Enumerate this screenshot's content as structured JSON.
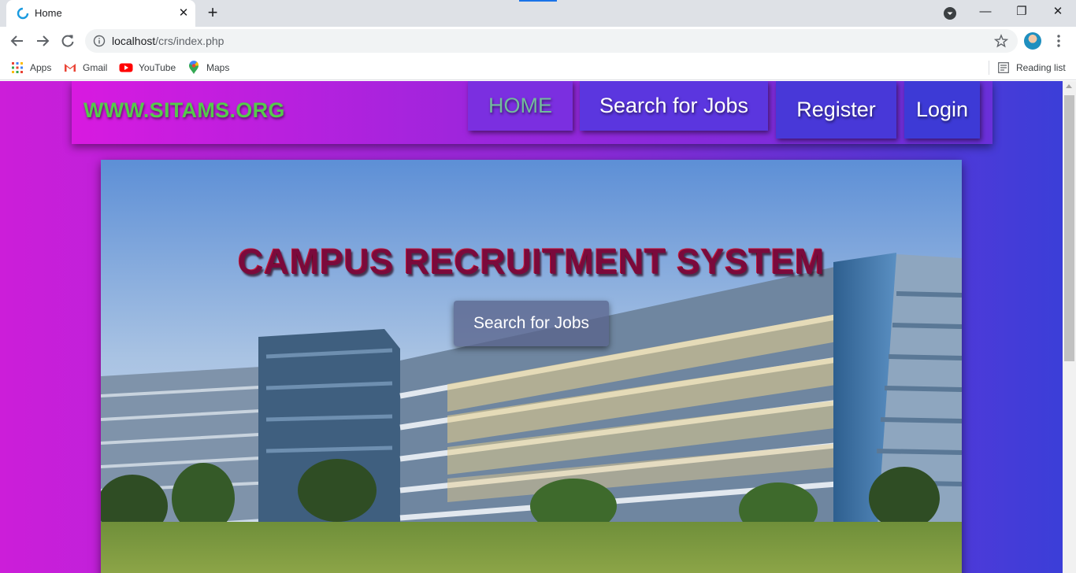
{
  "browser": {
    "tab": {
      "title": "Home",
      "close_icon": "close-icon"
    },
    "new_tab_label": "+",
    "window_controls": {
      "minimize": "—",
      "restore": "❐",
      "close": "✕"
    },
    "address": {
      "host": "localhost",
      "path": "/crs/index.php"
    },
    "bookmarks": [
      {
        "label": "Apps",
        "icon": "apps-grid-icon"
      },
      {
        "label": "Gmail",
        "icon": "gmail-icon"
      },
      {
        "label": "YouTube",
        "icon": "youtube-icon"
      },
      {
        "label": "Maps",
        "icon": "maps-icon"
      }
    ],
    "reading_list": "Reading list"
  },
  "site": {
    "logo": "WWW.SITAMS.ORG",
    "nav": {
      "home": "HOME",
      "search": "Search for Jobs",
      "register": "Register",
      "login": "Login"
    },
    "hero": {
      "title": "CAMPUS RECRUITMENT SYSTEM",
      "button": "Search for Jobs"
    }
  },
  "colors": {
    "page_gradient": [
      "#cc1ed9",
      "#3b3ed8"
    ],
    "logo": "#56c94c",
    "hero_title": "#7a0a3c"
  }
}
